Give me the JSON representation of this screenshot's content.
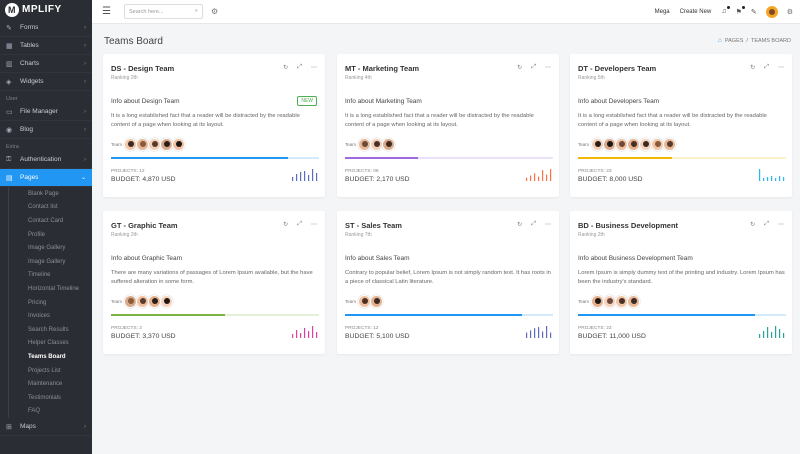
{
  "brand": {
    "badge": "M",
    "name": "MPLIFY"
  },
  "sidebar": {
    "top_items": [
      {
        "label": "Forms",
        "icon": "form-icon"
      },
      {
        "label": "Tables",
        "icon": "table-icon"
      },
      {
        "label": "Charts",
        "icon": "chart-icon"
      },
      {
        "label": "Widgets",
        "icon": "widget-icon"
      }
    ],
    "section_user": "User",
    "user_items": [
      {
        "label": "File Manager",
        "icon": "folder-icon"
      },
      {
        "label": "Blog",
        "icon": "blog-icon"
      }
    ],
    "section_extra": "Extra",
    "auth_label": "Authentication",
    "pages_label": "Pages",
    "sub_items": [
      "Blank Page",
      "Contact list",
      "Contact Card",
      "Profile",
      "Image Gallery",
      "Image Gallery",
      "Timeline",
      "Horizontal Timeline",
      "Pricing",
      "Invoices",
      "Search Results",
      "Helper Classes",
      "Teams Board",
      "Projects List",
      "Maintenance",
      "Testimonials",
      "FAQ"
    ],
    "maps_label": "Maps"
  },
  "topbar": {
    "search_placeholder": "Search here...",
    "mega": "Mega",
    "create_new": "Create New"
  },
  "page": {
    "title": "Teams Board",
    "breadcrumb": [
      "PAGES",
      "/",
      "TEAMS BOARD"
    ]
  },
  "cards": [
    {
      "title": "DS - Design Team",
      "rank": "Ranking 2th",
      "info": "Info about Design Team",
      "badge": "NEW",
      "desc": "It is a long established fact that a reader will be distracted by the readable content of a page when looking at its layout.",
      "team_label": "Team",
      "avatars": 5,
      "progress": 0.85,
      "color": "#2196f3",
      "projects": "PROJECTS: 12",
      "budget": "BUDGET: 4,870 USD",
      "spark": [
        4,
        7,
        9,
        10,
        6,
        12,
        8
      ]
    },
    {
      "title": "MT - Marketing Team",
      "rank": "Ranking 4th",
      "info": "Info about Marketing Team",
      "badge": "",
      "desc": "It is a long established fact that a reader will be distracted by the readable content of a page when looking at its layout.",
      "team_label": "Team",
      "avatars": 3,
      "progress": 0.35,
      "color": "#9c6ade",
      "projects": "PROJECTS: 08",
      "budget": "BUDGET: 2,170 USD",
      "spark": [
        3,
        5,
        7,
        4,
        10,
        6,
        11
      ]
    },
    {
      "title": "DT - Developers Team",
      "rank": "Ranking 5th",
      "info": "Info about Developers Team",
      "badge": "",
      "desc": "It is a long established fact that a reader will be distracted by the readable content of a page when looking at its layout.",
      "team_label": "Team",
      "avatars": 7,
      "progress": 0.45,
      "color": "#f5b800",
      "projects": "PROJECTS: 23",
      "budget": "BUDGET: 8,000 USD",
      "spark": [
        12,
        3,
        4,
        5,
        3,
        5,
        4
      ]
    },
    {
      "title": "GT - Graphic Team",
      "rank": "Ranking 2th",
      "info": "Info about Graphic Team",
      "badge": "",
      "desc": "There are many variations of passages of Lorem Ipsum available, but the have suffered alteration in some form.",
      "team_label": "Team",
      "avatars": 4,
      "progress": 0.55,
      "color": "#7cb342",
      "projects": "PROJECTS: 2",
      "budget": "BUDGET: 3,370 USD",
      "spark": [
        4,
        8,
        5,
        10,
        7,
        12,
        6
      ]
    },
    {
      "title": "ST - Sales Team",
      "rank": "Ranking 7th",
      "info": "Info about Sales Team",
      "badge": "",
      "desc": "Contrary to popular belief, Lorem Ipsum is not simply random text. It has roots in a piece of classical Latin literature.",
      "team_label": "Team",
      "avatars": 2,
      "progress": 0.85,
      "color": "#2196f3",
      "projects": "PROJECTS: 12",
      "budget": "BUDGET: 5,100 USD",
      "spark": [
        5,
        7,
        9,
        10,
        6,
        11,
        5
      ]
    },
    {
      "title": "BD - Business Development",
      "rank": "Ranking 2th",
      "info": "Info about Business Development Team",
      "badge": "",
      "desc": "Lorem Ipsum is simply dummy text of the printing and industry. Lorem Ipsum has been the industry's standard.",
      "team_label": "Team",
      "avatars": 4,
      "progress": 0.85,
      "color": "#2196f3",
      "projects": "PROJECTS: 23",
      "budget": "BUDGET: 11,000 USD",
      "spark": [
        4,
        7,
        11,
        6,
        12,
        9,
        5
      ]
    }
  ]
}
